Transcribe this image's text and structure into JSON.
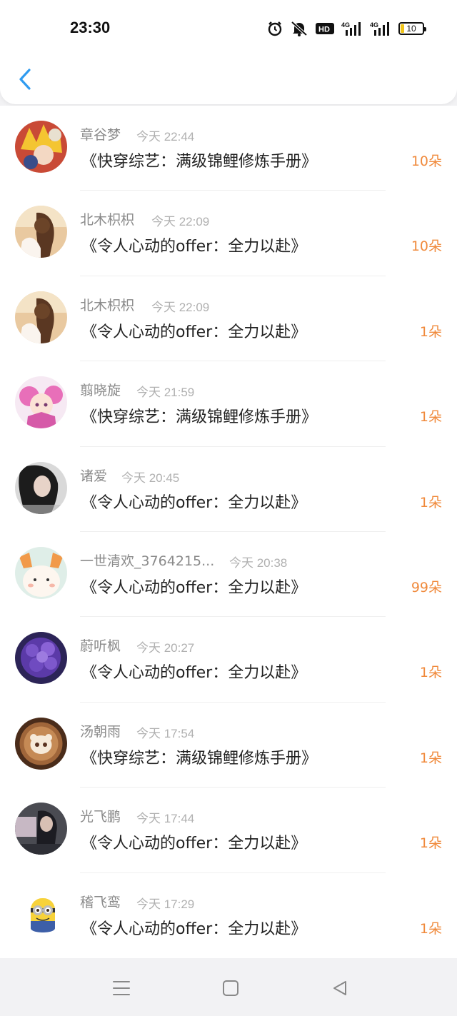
{
  "status_bar": {
    "time": "23:30",
    "network_label": "4G",
    "hd_label": "HD",
    "battery_level": "10"
  },
  "header": {
    "back_icon": "chevron-left-icon"
  },
  "colors": {
    "accent": "#2f9bf0",
    "amount": "#f08a3c",
    "name": "#8a8a8a",
    "time": "#b0b0b0"
  },
  "gifts": [
    {
      "name": "章谷梦",
      "time": "今天 22:44",
      "book": "《快穿综艺：满级锦鲤修炼手册》",
      "amount": "10朵"
    },
    {
      "name": "北木枳枳",
      "time": "今天 22:09",
      "book": "《令人心动的offer：全力以赴》",
      "amount": "10朵"
    },
    {
      "name": "北木枳枳",
      "time": "今天 22:09",
      "book": "《令人心动的offer：全力以赴》",
      "amount": "1朵"
    },
    {
      "name": "翦晓旋",
      "time": "今天 21:59",
      "book": "《快穿综艺：满级锦鲤修炼手册》",
      "amount": "1朵"
    },
    {
      "name": "诸爱",
      "time": "今天 20:45",
      "book": "《令人心动的offer：全力以赴》",
      "amount": "1朵"
    },
    {
      "name": "一世清欢_3764215...",
      "time": "今天 20:38",
      "book": "《令人心动的offer：全力以赴》",
      "amount": "99朵"
    },
    {
      "name": "蔚听枫",
      "time": "今天 20:27",
      "book": "《令人心动的offer：全力以赴》",
      "amount": "1朵"
    },
    {
      "name": "汤朝雨",
      "time": "今天 17:54",
      "book": "《快穿综艺：满级锦鲤修炼手册》",
      "amount": "1朵"
    },
    {
      "name": "光飞鹏",
      "time": "今天 17:44",
      "book": "《令人心动的offer：全力以赴》",
      "amount": "1朵"
    },
    {
      "name": "稽飞鸾",
      "time": "今天 17:29",
      "book": "《令人心动的offer：全力以赴》",
      "amount": "1朵"
    }
  ],
  "navigation": {
    "menu_icon": "menu-icon",
    "home_icon": "square-home-icon",
    "back_icon": "triangle-back-icon"
  }
}
